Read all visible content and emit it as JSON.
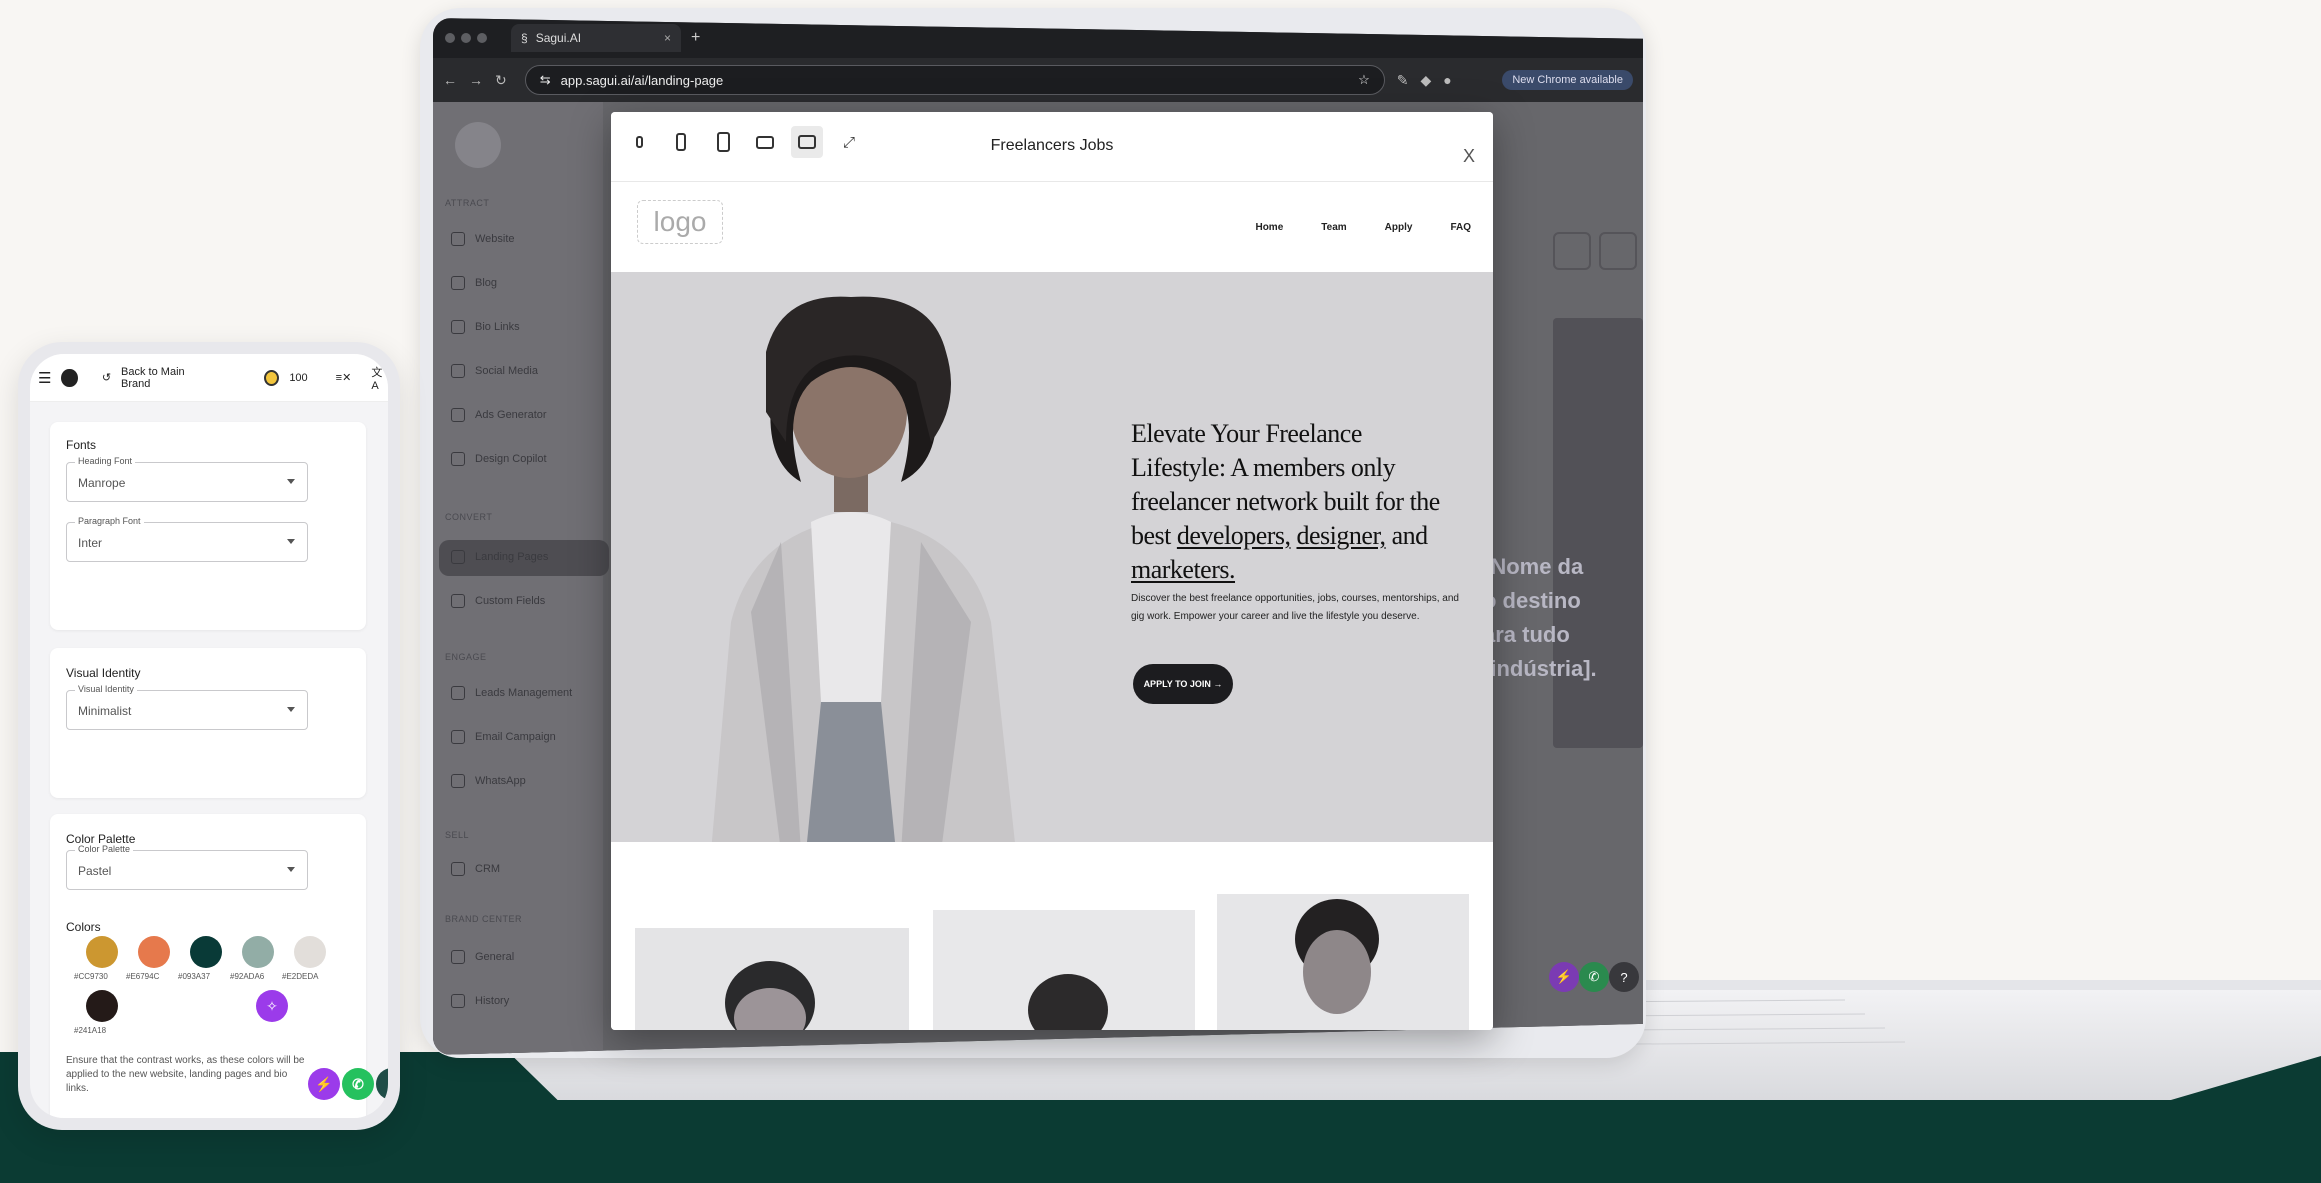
{
  "browser": {
    "tab_title": "Sagui.AI",
    "tab_close": "×",
    "new_tab": "+",
    "url": "app.sagui.ai/ai/landing-page",
    "chrome_notice": "New Chrome available"
  },
  "sidebar": {
    "section_attract": "ATTRACT",
    "section_convert": "CONVERT",
    "section_engage": "ENGAGE",
    "section_sell": "SELL",
    "section_brand": "BRAND CENTER",
    "items": [
      {
        "label": "Website"
      },
      {
        "label": "Blog"
      },
      {
        "label": "Bio Links"
      },
      {
        "label": "Social Media"
      },
      {
        "label": "Ads Generator"
      },
      {
        "label": "Design Copilot"
      },
      {
        "label": "Landing Pages"
      },
      {
        "label": "Custom Fields"
      },
      {
        "label": "Leads Management"
      },
      {
        "label": "Email Campaign"
      },
      {
        "label": "WhatsApp"
      },
      {
        "label": "CRM"
      },
      {
        "label": "General"
      },
      {
        "label": "History"
      }
    ]
  },
  "background_app": {
    "right_text_lines": [
      "[Nome da",
      "o destino",
      "ara tudo",
      "[indústria]."
    ]
  },
  "modal": {
    "title": "Freelancers Jobs",
    "close": "X",
    "device_icons": [
      "watch-icon",
      "phone-small-icon",
      "tablet-icon",
      "laptop-icon",
      "desktop-icon",
      "fullscreen-icon"
    ]
  },
  "site": {
    "logo": "logo",
    "nav": [
      "Home",
      "Team",
      "Apply",
      "FAQ"
    ],
    "hero_title_1": "Elevate Your Freelance Lifestyle: A members only freelancer network built for the best ",
    "hero_title_dev": "developers,",
    "hero_title_des": "designer,",
    "hero_title_and": " and ",
    "hero_title_mkt": "marketers.",
    "hero_sub": "Discover the best freelance opportunities, jobs, courses, mentorships, and gig work. Empower your career and live the lifestyle you deserve.",
    "cta": "APPLY TO JOIN →"
  },
  "phone": {
    "back_label": "Back to Main Brand",
    "credits": "100",
    "fonts_title": "Fonts",
    "heading_font_label": "Heading Font",
    "heading_font_value": "Manrope",
    "paragraph_font_label": "Paragraph Font",
    "paragraph_font_value": "Inter",
    "visual_title": "Visual Identity",
    "visual_label": "Visual Identity",
    "visual_value": "Minimalist",
    "palette_title": "Color Palette",
    "palette_label": "Color Palette",
    "palette_value": "Pastel",
    "colors_title": "Colors",
    "colors": [
      {
        "hex": "#CC9730",
        "label": "#CC9730"
      },
      {
        "hex": "#E6794C",
        "label": "#E6794C"
      },
      {
        "hex": "#093A37",
        "label": "#093A37"
      },
      {
        "hex": "#92ADA6",
        "label": "#92ADA6"
      },
      {
        "hex": "#E2DEDA",
        "label": "#E2DEDA"
      },
      {
        "hex": "#241A18",
        "label": "#241A18"
      }
    ],
    "note": "Ensure that the contrast works, as these colors will be applied to the new website, landing pages and bio links."
  },
  "colors": {
    "accent_purple": "#9b3bea",
    "whatsapp_green": "#25c15e",
    "help_dark": "#1f4d47",
    "footer_band": "#0b3b33"
  }
}
